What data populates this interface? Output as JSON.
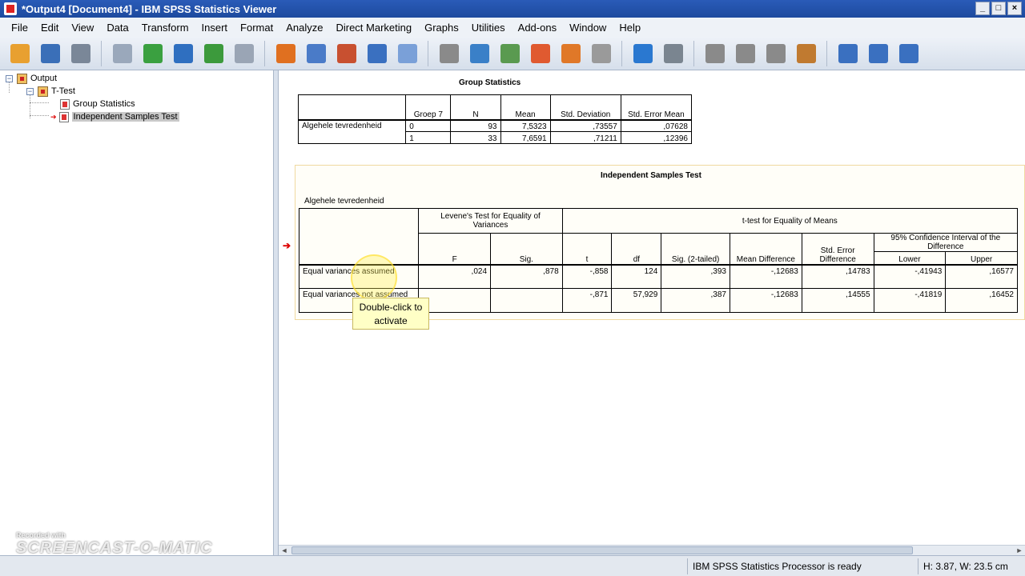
{
  "window": {
    "title": "*Output4 [Document4] - IBM SPSS Statistics Viewer"
  },
  "menu": [
    "File",
    "Edit",
    "View",
    "Data",
    "Transform",
    "Insert",
    "Format",
    "Analyze",
    "Direct Marketing",
    "Graphs",
    "Utilities",
    "Add-ons",
    "Window",
    "Help"
  ],
  "toolbar": {
    "buttons": [
      {
        "name": "open-icon",
        "color": "#e8a030"
      },
      {
        "name": "save-icon",
        "color": "#3a6fb8"
      },
      {
        "name": "print-icon",
        "color": "#7a8798"
      },
      {
        "name": "print-preview-icon",
        "color": "#9aa8bb"
      },
      {
        "name": "export-icon",
        "color": "#3aa040"
      },
      {
        "name": "recall-dialog-icon",
        "color": "#2f6fc0"
      },
      {
        "name": "undo-icon",
        "color": "#3c9a3c"
      },
      {
        "name": "redo-icon",
        "color": "#9aa5b5"
      },
      {
        "name": "goto-data-icon",
        "color": "#e07020"
      },
      {
        "name": "goto-case-icon",
        "color": "#4a7bc8"
      },
      {
        "name": "goto-variable-icon",
        "color": "#c85030"
      },
      {
        "name": "variables-icon",
        "color": "#3a70c0"
      },
      {
        "name": "designate-window-icon",
        "color": "#7aa0d8"
      },
      {
        "name": "select-cases-icon",
        "color": "#8a8a8a"
      },
      {
        "name": "weight-cases-icon",
        "color": "#3a80c8"
      },
      {
        "name": "value-labels-icon",
        "color": "#5a9a50"
      },
      {
        "name": "edit-chart-icon",
        "color": "#e05a30"
      },
      {
        "name": "run-script-icon",
        "color": "#e07828"
      },
      {
        "name": "disabled-icon",
        "color": "#9a9a9a"
      },
      {
        "name": "arrow-left-icon",
        "color": "#2a78d0"
      },
      {
        "name": "arrow-right-icon",
        "color": "#7a8590"
      },
      {
        "name": "expand-icon",
        "color": "#8a8a8a"
      },
      {
        "name": "collapse-icon",
        "color": "#8a8a8a"
      },
      {
        "name": "show-icon",
        "color": "#8a8a8a"
      },
      {
        "name": "hide-icon",
        "color": "#c07a30"
      },
      {
        "name": "insert-heading-icon",
        "color": "#3a70c0"
      },
      {
        "name": "insert-title-icon",
        "color": "#3a70c0"
      },
      {
        "name": "insert-text-icon",
        "color": "#3a70c0"
      }
    ]
  },
  "outline": {
    "root": "Output",
    "ttest": "T-Test",
    "item1": "Group Statistics",
    "item2": "Independent Samples Test"
  },
  "group_stats": {
    "title": "Group Statistics",
    "headers": [
      "Groep 7",
      "N",
      "Mean",
      "Std. Deviation",
      "Std. Error Mean"
    ],
    "row_label": "Algehele tevredenheid",
    "rows": [
      [
        "0",
        "93",
        "7,5323",
        ",73557",
        ",07628"
      ],
      [
        "1",
        "33",
        "7,6591",
        ",71211",
        ",12396"
      ]
    ]
  },
  "ind_test": {
    "title": "Independent Samples Test",
    "subtitle": "Algehele tevredenheid",
    "levene": "Levene's Test for Equality of Variances",
    "ttest": "t-test for Equality of Means",
    "ci": "95% Confidence Interval of the Difference",
    "cols": [
      "F",
      "Sig.",
      "t",
      "df",
      "Sig. (2-tailed)",
      "Mean Difference",
      "Std. Error Difference",
      "Lower",
      "Upper"
    ],
    "row1_label": "Equal variances assumed",
    "row1": [
      ",024",
      ",878",
      "-,858",
      "124",
      ",393",
      "-,12683",
      ",14783",
      "-,41943",
      ",16577"
    ],
    "row2_label": "Equal variances not assumed",
    "row2": [
      "",
      "",
      "-,871",
      "57,929",
      ",387",
      "-,12683",
      ",14555",
      "-,41819",
      ",16452"
    ]
  },
  "tooltip": "Double-click to activate",
  "status": {
    "processor": "IBM SPSS Statistics Processor is ready",
    "size": "H: 3.87, W: 23.5 cm"
  },
  "watermark": {
    "line1": "Recorded with",
    "line2": "SCREENCAST-O-MATIC"
  }
}
